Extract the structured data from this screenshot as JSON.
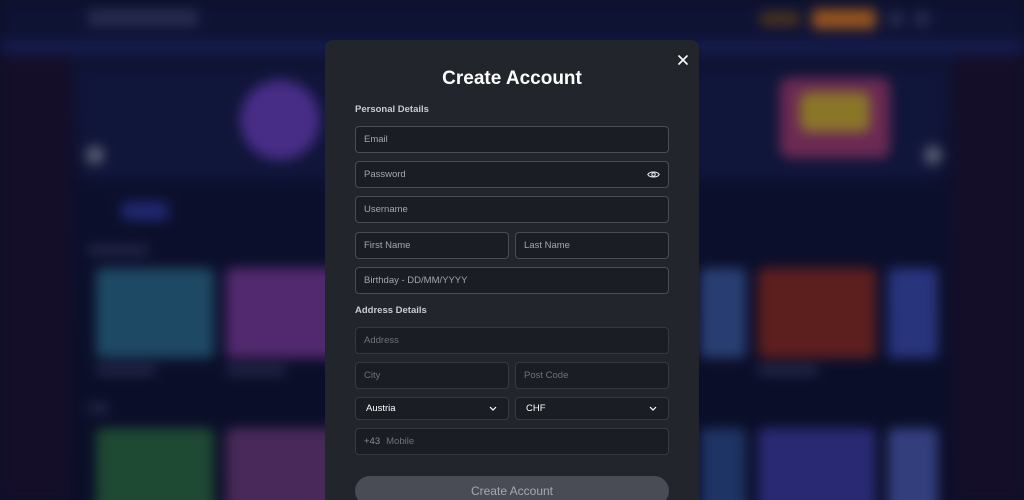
{
  "modal": {
    "title": "Create Account",
    "close_icon": "close-icon"
  },
  "personal": {
    "section_label": "Personal Details",
    "email_placeholder": "Email",
    "password_placeholder": "Password",
    "password_toggle_icon": "eye-icon",
    "username_placeholder": "Username",
    "first_name_placeholder": "First Name",
    "last_name_placeholder": "Last Name",
    "birthday_placeholder": "Birthday - DD/MM/YYYY"
  },
  "address": {
    "section_label": "Address Details",
    "address_placeholder": "Address",
    "city_placeholder": "City",
    "postcode_placeholder": "Post Code",
    "country_selected": "Austria",
    "currency_selected": "CHF",
    "phone_prefix": "+43",
    "mobile_placeholder": "Mobile",
    "dropdown_icon": "chevron-down-icon"
  },
  "submit_label": "Create Account",
  "colors": {
    "modal_bg": "#23252d",
    "field_bg": "#1b1d24",
    "field_border": "#4a4d57",
    "button_bg": "#4a4c55",
    "page_bg": "#0f1330"
  }
}
